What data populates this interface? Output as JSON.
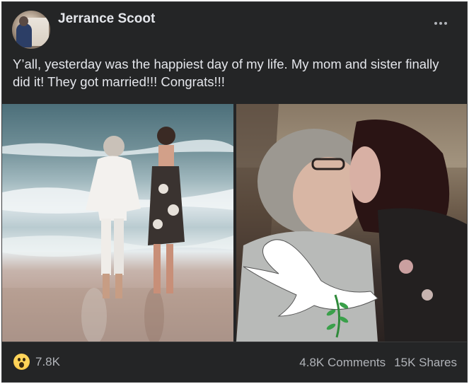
{
  "post": {
    "author": "Jerrance Scoot",
    "text": "Y’all, yesterday was the happiest day of my life. My mom and sister finally did it! They got married!!! Congrats!!!",
    "photos": [
      {
        "label": "beach-couple-photo"
      },
      {
        "label": "kiss-photo-with-dove"
      }
    ]
  },
  "reactions": {
    "icon": "wow-emoji-icon",
    "count": "7.8K"
  },
  "stats": {
    "comments": "4.8K Comments",
    "shares": "15K Shares"
  },
  "colors": {
    "background": "#242526",
    "text": "#e4e6eb",
    "muted": "#b0b3b8"
  }
}
